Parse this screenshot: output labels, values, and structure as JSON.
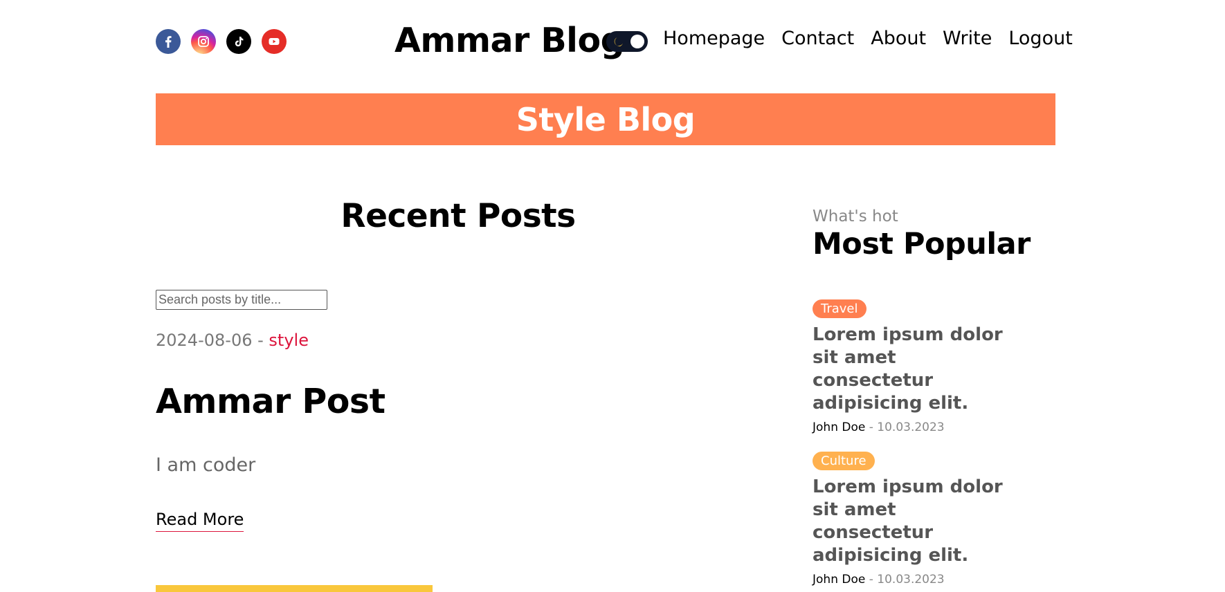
{
  "header": {
    "social": [
      {
        "icon": "facebook-icon",
        "color": "#3b5998"
      },
      {
        "icon": "instagram-icon",
        "color": "#d6249f"
      },
      {
        "icon": "tiktok-icon",
        "color": "#000000"
      },
      {
        "icon": "youtube-icon",
        "color": "#e52d27"
      }
    ],
    "logo": "Ammar Blog",
    "theme_toggle": {
      "icon": "moon-icon",
      "mode": "dark"
    },
    "nav": [
      "Homepage",
      "Contact",
      "About",
      "Write",
      "Logout"
    ]
  },
  "banner": {
    "title": "Style Blog",
    "color": "#ff7f50"
  },
  "recent": {
    "title": "Recent Posts",
    "search_placeholder": "Search posts by title...",
    "posts": [
      {
        "date": "2024-08-06",
        "separator": " - ",
        "category": "style",
        "title": "Ammar Post",
        "description": "I am coder",
        "read_more": "Read More"
      }
    ]
  },
  "sidebar": {
    "subtitle": "What's hot",
    "title": "Most Popular",
    "items": [
      {
        "category": "Travel",
        "category_color": "#ff7f50",
        "title": "Lorem ipsum dolor sit amet consectetur adipisicing elit.",
        "author": "John Doe",
        "separator": " - ",
        "date": "10.03.2023"
      },
      {
        "category": "Culture",
        "category_color": "#ffb14f",
        "title": "Lorem ipsum dolor sit amet consectetur adipisicing elit.",
        "author": "John Doe",
        "separator": " - ",
        "date": "10.03.2023"
      }
    ]
  },
  "colors": {
    "accent": "#dc143c",
    "highlight_bar": "#f9c73c"
  }
}
